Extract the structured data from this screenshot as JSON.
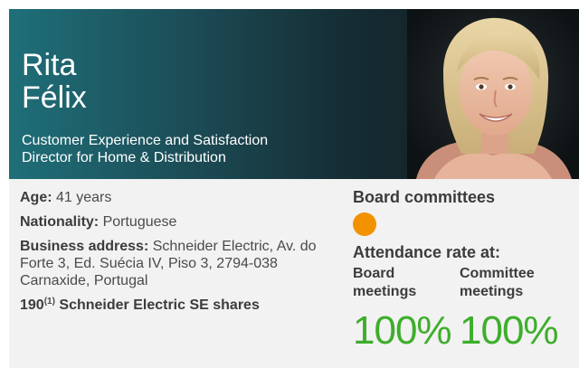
{
  "profile": {
    "first_name": "Rita",
    "last_name": "Félix",
    "role_line1": "Customer Experience and Satisfaction",
    "role_line2": "Director for Home & Distribution"
  },
  "info": {
    "age_label": "Age:",
    "age_value": "41 years",
    "nationality_label": "Nationality:",
    "nationality_value": "Portuguese",
    "address_label": "Business address:",
    "address_value": "Schneider Electric, Av. do Forte 3, Ed. Suécia IV, Piso 3, 2794-038 Carnaxide, Portugal",
    "shares_count": "190",
    "shares_note": "(1)",
    "shares_text": "Schneider Electric SE shares"
  },
  "committees": {
    "heading": "Board committees",
    "dot_color": "#f39200"
  },
  "attendance": {
    "heading": "Attendance rate at:",
    "board_label_1": "Board",
    "board_label_2": "meetings",
    "board_value": "100%",
    "committee_label_1": "Committee",
    "committee_label_2": "meetings",
    "committee_value": "100%",
    "value_color": "#3dae2b"
  }
}
